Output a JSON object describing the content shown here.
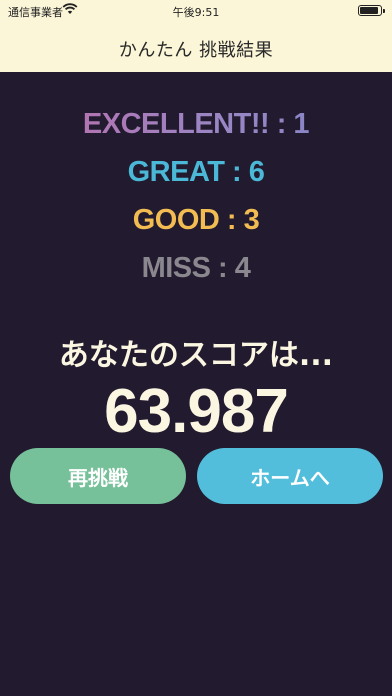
{
  "status_bar": {
    "carrier": "通信事業者",
    "time": "午後9:51"
  },
  "nav": {
    "title": "かんたん 挑戦結果"
  },
  "results": [
    {
      "label": "EXCELLENT!!",
      "separator": " : ",
      "count": "1",
      "color": "#b67cb6"
    },
    {
      "label": "GREAT",
      "separator": " : ",
      "count": "6",
      "color": "#4ab8d6"
    },
    {
      "label": "GOOD",
      "separator": " : ",
      "count": "3",
      "color": "#f3bc52"
    },
    {
      "label": "MISS",
      "separator": " : ",
      "count": "4",
      "color": "#8a878f"
    }
  ],
  "score": {
    "label": "あなたのスコアは...",
    "value": "63.987"
  },
  "buttons": {
    "retry": "再挑戦",
    "home": "ホームへ"
  },
  "colors": {
    "background": "#221a2e",
    "header": "#fbf6d8",
    "retry_button": "#76c09a",
    "home_button": "#52bedb"
  }
}
